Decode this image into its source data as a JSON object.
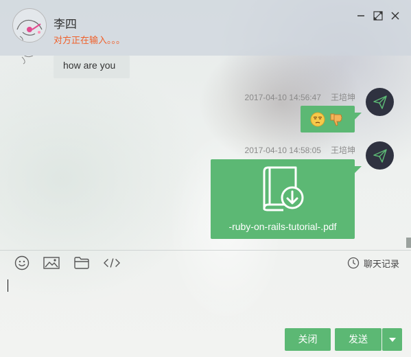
{
  "header": {
    "contact_name": "李四",
    "typing_status": "对方正在输入。。。",
    "avatar_icon": "doodle-avatar-icon",
    "window_controls": [
      "minimize-icon",
      "maximize-icon",
      "close-icon"
    ]
  },
  "messages": [
    {
      "direction": "incoming",
      "type": "text",
      "text": "how are you"
    },
    {
      "direction": "outgoing",
      "timestamp": "2017-04-10 14:56:47",
      "sender": "王培坤",
      "type": "emoji",
      "emojis": [
        "unamused-face-icon",
        "thumbs-down-icon"
      ]
    },
    {
      "direction": "outgoing",
      "timestamp": "2017-04-10 14:58:05",
      "sender": "王培坤",
      "type": "file",
      "file_name": "-ruby-on-rails-tutorial-.pdf",
      "icon": "book-download-icon"
    }
  ],
  "toolbar": {
    "tools": [
      "emoji-icon",
      "image-icon",
      "folder-icon",
      "code-icon"
    ],
    "history_label": "聊天记录",
    "history_icon": "clock-icon"
  },
  "footer": {
    "close_label": "关闭",
    "send_label": "发送",
    "dropdown_icon": "caret-down-icon"
  },
  "colors": {
    "accent_green": "#5cb874",
    "typing_orange": "#f0602a",
    "avatar_dark": "#2f3240"
  }
}
